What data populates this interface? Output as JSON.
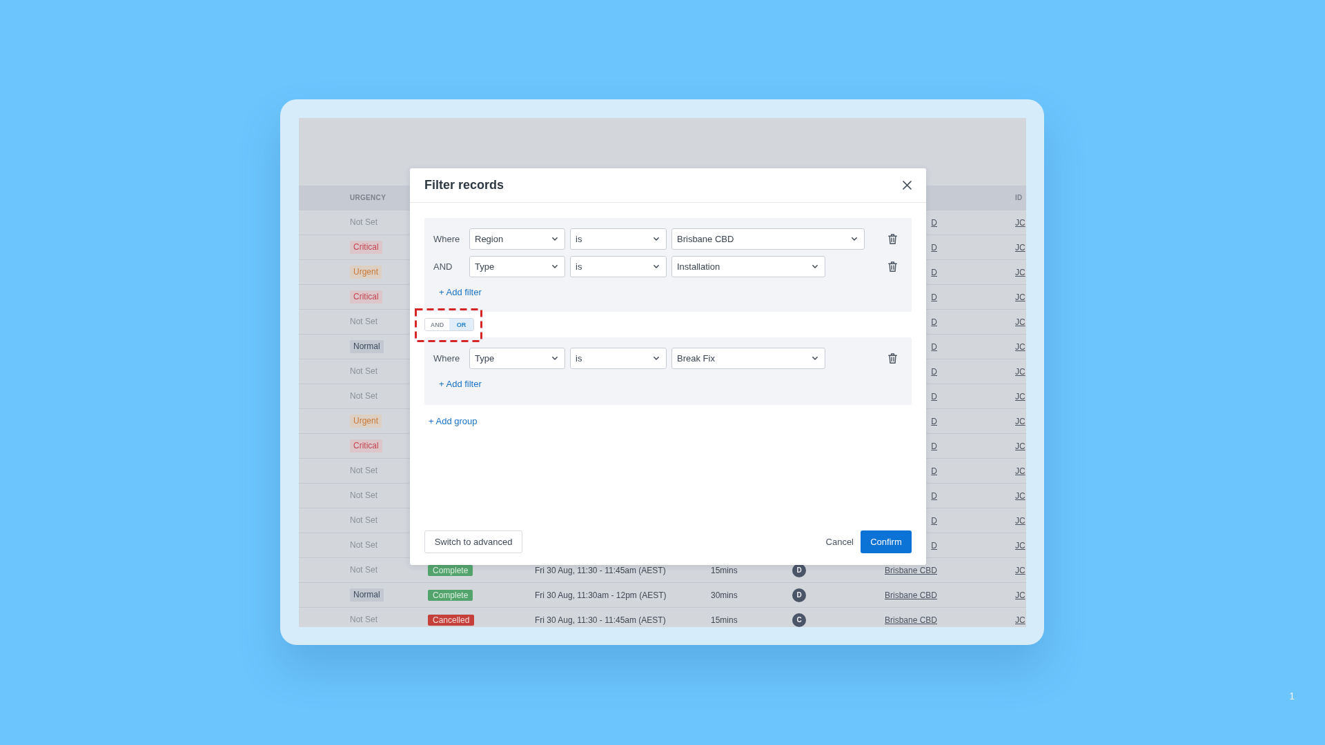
{
  "table": {
    "columns": [
      {
        "kind": "urgency",
        "label": "URGENCY"
      },
      {
        "kind": "id",
        "label": "ID"
      }
    ],
    "rows": [
      {
        "urgency": {
          "label": "Not Set",
          "kind": "none"
        },
        "region": "D",
        "id": "JC"
      },
      {
        "urgency": {
          "label": "Critical",
          "kind": "critical"
        },
        "region": "D",
        "id": "JC"
      },
      {
        "urgency": {
          "label": "Urgent",
          "kind": "urgent"
        },
        "region": "D",
        "id": "JC"
      },
      {
        "urgency": {
          "label": "Critical",
          "kind": "critical"
        },
        "region": "D",
        "id": "JC"
      },
      {
        "urgency": {
          "label": "Not Set",
          "kind": "none"
        },
        "region": "D",
        "id": "JC"
      },
      {
        "urgency": {
          "label": "Normal",
          "kind": "normal"
        },
        "region": "D",
        "id": "JC"
      },
      {
        "urgency": {
          "label": "Not Set",
          "kind": "none"
        },
        "region": "D",
        "id": "JC"
      },
      {
        "urgency": {
          "label": "Not Set",
          "kind": "none"
        },
        "region": "D",
        "id": "JC"
      },
      {
        "urgency": {
          "label": "Urgent",
          "kind": "urgent"
        },
        "region": "D",
        "id": "JC"
      },
      {
        "urgency": {
          "label": "Critical",
          "kind": "critical"
        },
        "region": "D",
        "id": "JC"
      },
      {
        "urgency": {
          "label": "Not Set",
          "kind": "none"
        },
        "region": "D",
        "id": "JC"
      },
      {
        "urgency": {
          "label": "Not Set",
          "kind": "none"
        },
        "region": "D",
        "id": "JC"
      },
      {
        "urgency": {
          "label": "Not Set",
          "kind": "none"
        },
        "region": "D",
        "id": "JC"
      },
      {
        "urgency": {
          "label": "Not Set",
          "kind": "none"
        },
        "region": "D",
        "id": "JC"
      },
      {
        "urgency": {
          "label": "Not Set",
          "kind": "none"
        },
        "status": {
          "label": "Complete",
          "kind": "complete"
        },
        "time": "Fri 30 Aug, 11:30 - 11:45am (AEST)",
        "duration": "15mins",
        "assignee": "D",
        "region": "Brisbane CBD",
        "id": "JC"
      },
      {
        "urgency": {
          "label": "Normal",
          "kind": "normal"
        },
        "status": {
          "label": "Complete",
          "kind": "complete"
        },
        "time": "Fri 30 Aug, 11:30am - 12pm (AEST)",
        "duration": "30mins",
        "assignee": "D",
        "region": "Brisbane CBD",
        "id": "JC"
      },
      {
        "urgency": {
          "label": "Not Set",
          "kind": "none"
        },
        "status": {
          "label": "Cancelled",
          "kind": "cancelled"
        },
        "time": "Fri 30 Aug, 11:30 - 11:45am (AEST)",
        "duration": "15mins",
        "assignee": "C",
        "region": "Brisbane CBD",
        "id": "JC"
      }
    ]
  },
  "modal": {
    "title": "Filter records",
    "groups": [
      {
        "filters": [
          {
            "connector": "Where",
            "field": "Region",
            "operator": "is",
            "value": "Brisbane CBD"
          },
          {
            "connector": "AND",
            "field": "Type",
            "operator": "is",
            "value": "Installation"
          }
        ],
        "add_filter": "+ Add filter"
      },
      {
        "filters": [
          {
            "connector": "Where",
            "field": "Type",
            "operator": "is",
            "value": "Break Fix"
          }
        ],
        "add_filter": "+ Add filter"
      }
    ],
    "group_combinator": {
      "options": [
        {
          "label": "AND",
          "selected": false
        },
        {
          "label": "OR",
          "selected": true
        }
      ],
      "highlighted": true
    },
    "add_group": "+ Add group",
    "footer": {
      "switch": "Switch to advanced",
      "cancel": "Cancel",
      "confirm": "Confirm"
    }
  },
  "page_number": "1"
}
